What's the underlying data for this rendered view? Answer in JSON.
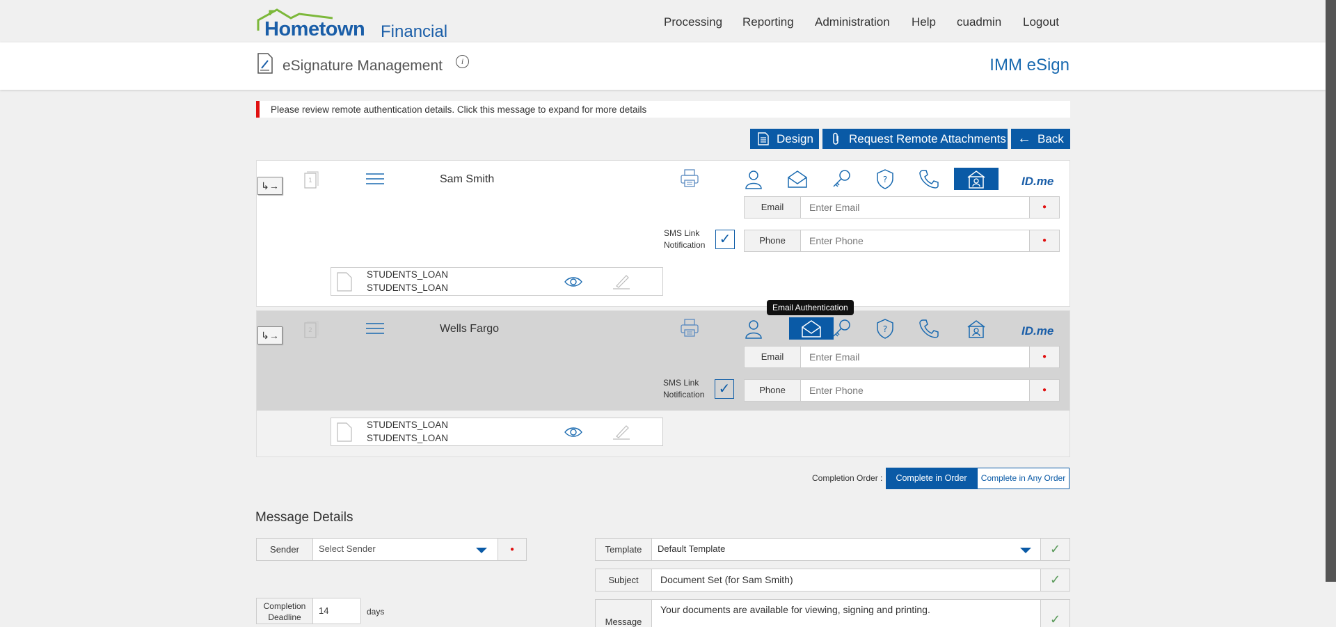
{
  "brand": {
    "name": "Hometown",
    "suffix": "Financial"
  },
  "nav": [
    "Processing",
    "Reporting",
    "Administration",
    "Help",
    "cuadmin",
    "Logout"
  ],
  "page": {
    "title": "eSignature Management",
    "product": "IMM eSign"
  },
  "alert": "Please review remote authentication details. Click this message to expand for more details",
  "actions": {
    "design": "Design",
    "attachments": "Request Remote Attachments",
    "back": "Back"
  },
  "signers": [
    {
      "name": "Sam Smith",
      "email_label": "Email",
      "email_placeholder": "Enter Email",
      "phone_label": "Phone",
      "phone_placeholder": "Enter Phone",
      "sms_label_1": "SMS Link",
      "sms_label_2": "Notification",
      "doc_line1": "STUDENTS_LOAN",
      "doc_line2": "STUDENTS_LOAN",
      "selected_auth": "id-verification"
    },
    {
      "name": "Wells Fargo",
      "email_label": "Email",
      "email_placeholder": "Enter Email",
      "phone_label": "Phone",
      "phone_placeholder": "Enter Phone",
      "sms_label_1": "SMS Link",
      "sms_label_2": "Notification",
      "doc_line1": "STUDENTS_LOAN",
      "doc_line2": "STUDENTS_LOAN",
      "selected_auth": "email-authentication"
    }
  ],
  "idme_label": "ID.me",
  "tooltip": "Email Authentication",
  "completion": {
    "label": "Completion Order :",
    "in_order": "Complete in Order",
    "any_order": "Complete in Any Order",
    "selected": "in_order"
  },
  "message": {
    "section_title": "Message Details",
    "sender_label": "Sender",
    "sender_placeholder": "Select Sender",
    "template_label": "Template",
    "template_value": "Default Template",
    "subject_label": "Subject",
    "subject_value": "Document Set (for Sam Smith)",
    "message_label": "Message",
    "message_value": "Your documents are available for viewing, signing and printing.",
    "deadline_label_1": "Completion",
    "deadline_label_2": "Deadline",
    "deadline_value": "14",
    "deadline_unit": "days"
  },
  "colors": {
    "primary": "#0a5aa6",
    "alert": "#e01010",
    "check": "#5a9a5a"
  }
}
